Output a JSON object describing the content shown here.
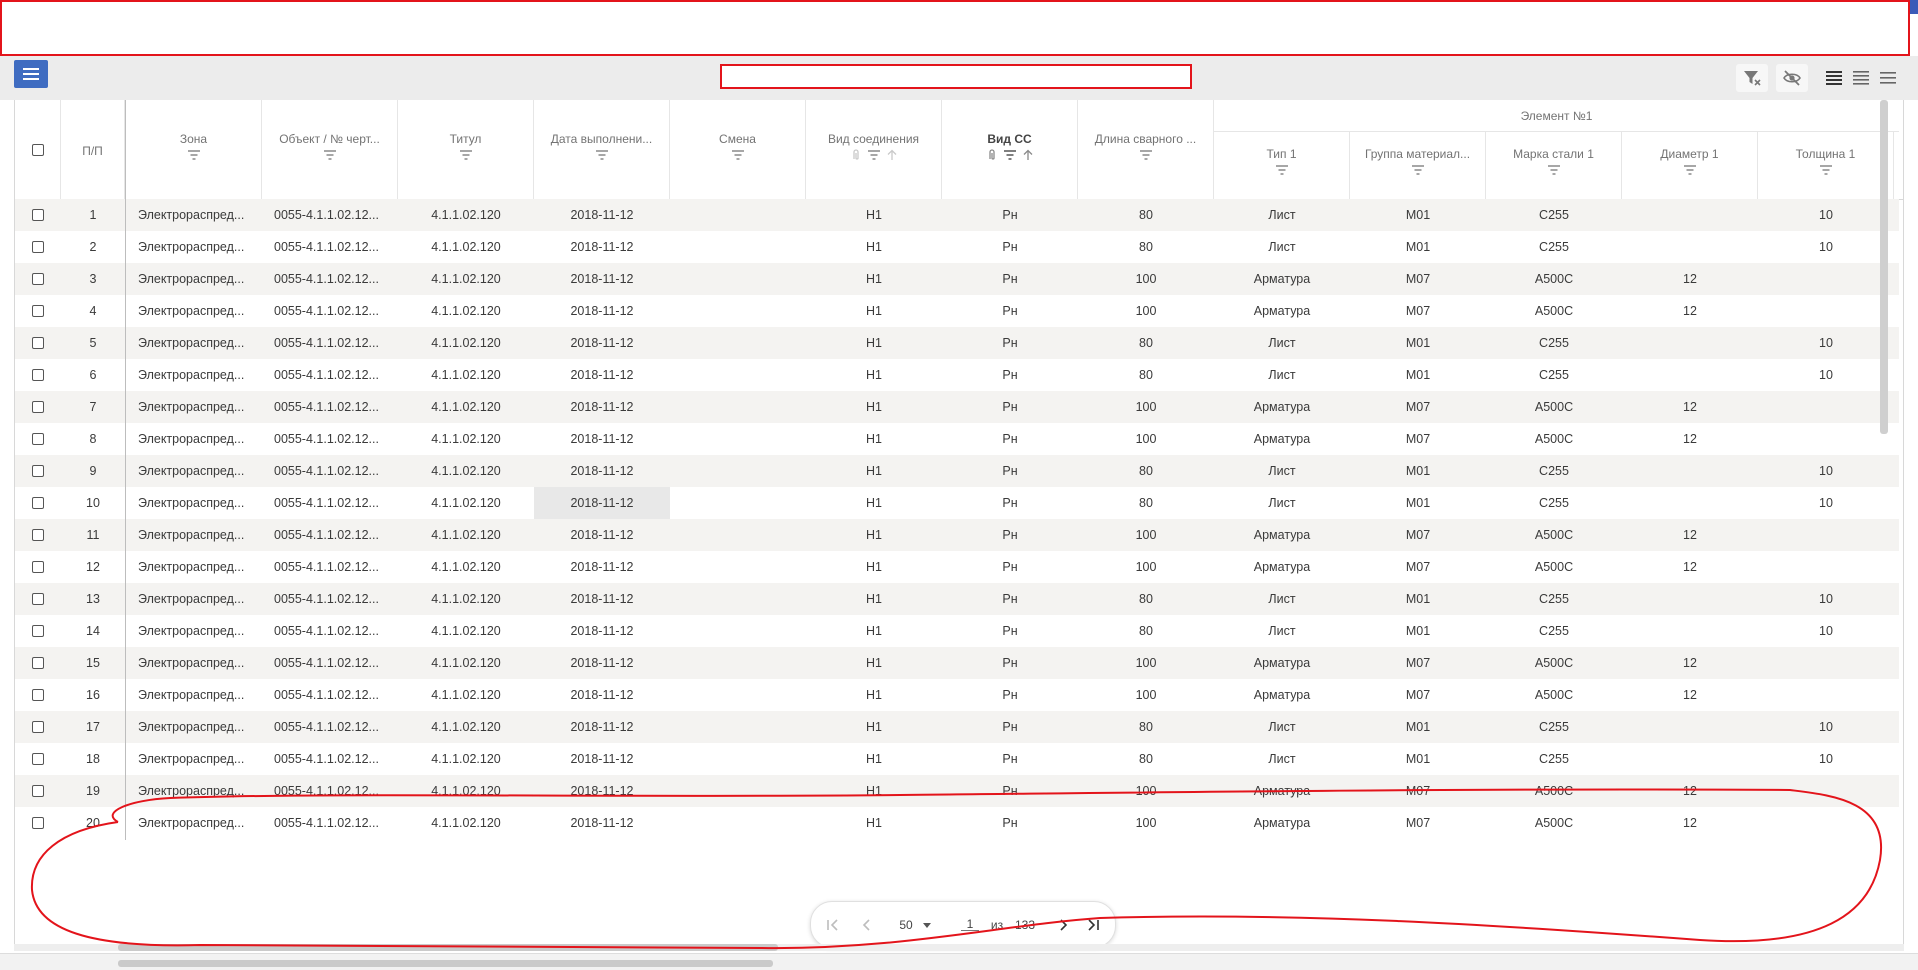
{
  "toolbar": {
    "menu_icon": "hamburger-menu-icon",
    "tools": [
      "filter-clear-icon",
      "hide-columns-icon",
      "density-compact-icon",
      "density-standard-icon",
      "density-comfortable-icon"
    ]
  },
  "table": {
    "columns": {
      "pp": "П/П",
      "zone": "Зона",
      "object": "Объект / № черт...",
      "title": "Титул",
      "date": "Дата выполнени...",
      "shift": "Смена",
      "joint_type": "Вид соединения",
      "ss_type": "Вид СС",
      "weld_length": "Длина сварного ...",
      "group": "Элемент №1",
      "type1": "Тип 1",
      "material_group": "Группа материал...",
      "steel_grade": "Марка стали 1",
      "diameter": "Диаметр 1",
      "thickness": "Толщина 1"
    },
    "rows": [
      [
        "1",
        "Электрораспред...",
        "0055-4.1.1.02.12...",
        "4.1.1.02.120",
        "2018-11-12",
        "",
        "Н1",
        "Рн",
        "80",
        "Лист",
        "М01",
        "С255",
        "",
        "10"
      ],
      [
        "2",
        "Электрораспред...",
        "0055-4.1.1.02.12...",
        "4.1.1.02.120",
        "2018-11-12",
        "",
        "Н1",
        "Рн",
        "80",
        "Лист",
        "М01",
        "С255",
        "",
        "10"
      ],
      [
        "3",
        "Электрораспред...",
        "0055-4.1.1.02.12...",
        "4.1.1.02.120",
        "2018-11-12",
        "",
        "Н1",
        "Рн",
        "100",
        "Арматура",
        "М07",
        "А500С",
        "12",
        ""
      ],
      [
        "4",
        "Электрораспред...",
        "0055-4.1.1.02.12...",
        "4.1.1.02.120",
        "2018-11-12",
        "",
        "Н1",
        "Рн",
        "100",
        "Арматура",
        "М07",
        "А500С",
        "12",
        ""
      ],
      [
        "5",
        "Электрораспред...",
        "0055-4.1.1.02.12...",
        "4.1.1.02.120",
        "2018-11-12",
        "",
        "Н1",
        "Рн",
        "80",
        "Лист",
        "М01",
        "С255",
        "",
        "10"
      ],
      [
        "6",
        "Электрораспред...",
        "0055-4.1.1.02.12...",
        "4.1.1.02.120",
        "2018-11-12",
        "",
        "Н1",
        "Рн",
        "80",
        "Лист",
        "М01",
        "С255",
        "",
        "10"
      ],
      [
        "7",
        "Электрораспред...",
        "0055-4.1.1.02.12...",
        "4.1.1.02.120",
        "2018-11-12",
        "",
        "Н1",
        "Рн",
        "100",
        "Арматура",
        "М07",
        "А500С",
        "12",
        ""
      ],
      [
        "8",
        "Электрораспред...",
        "0055-4.1.1.02.12...",
        "4.1.1.02.120",
        "2018-11-12",
        "",
        "Н1",
        "Рн",
        "100",
        "Арматура",
        "М07",
        "А500С",
        "12",
        ""
      ],
      [
        "9",
        "Электрораспред...",
        "0055-4.1.1.02.12...",
        "4.1.1.02.120",
        "2018-11-12",
        "",
        "Н1",
        "Рн",
        "80",
        "Лист",
        "М01",
        "С255",
        "",
        "10"
      ],
      [
        "10",
        "Электрораспред...",
        "0055-4.1.1.02.12...",
        "4.1.1.02.120",
        "2018-11-12",
        "",
        "Н1",
        "Рн",
        "80",
        "Лист",
        "М01",
        "С255",
        "",
        "10"
      ],
      [
        "11",
        "Электрораспред...",
        "0055-4.1.1.02.12...",
        "4.1.1.02.120",
        "2018-11-12",
        "",
        "Н1",
        "Рн",
        "100",
        "Арматура",
        "М07",
        "А500С",
        "12",
        ""
      ],
      [
        "12",
        "Электрораспред...",
        "0055-4.1.1.02.12...",
        "4.1.1.02.120",
        "2018-11-12",
        "",
        "Н1",
        "Рн",
        "100",
        "Арматура",
        "М07",
        "А500С",
        "12",
        ""
      ],
      [
        "13",
        "Электрораспред...",
        "0055-4.1.1.02.12...",
        "4.1.1.02.120",
        "2018-11-12",
        "",
        "Н1",
        "Рн",
        "80",
        "Лист",
        "М01",
        "С255",
        "",
        "10"
      ],
      [
        "14",
        "Электрораспред...",
        "0055-4.1.1.02.12...",
        "4.1.1.02.120",
        "2018-11-12",
        "",
        "Н1",
        "Рн",
        "80",
        "Лист",
        "М01",
        "С255",
        "",
        "10"
      ],
      [
        "15",
        "Электрораспред...",
        "0055-4.1.1.02.12...",
        "4.1.1.02.120",
        "2018-11-12",
        "",
        "Н1",
        "Рн",
        "100",
        "Арматура",
        "М07",
        "А500С",
        "12",
        ""
      ],
      [
        "16",
        "Электрораспред...",
        "0055-4.1.1.02.12...",
        "4.1.1.02.120",
        "2018-11-12",
        "",
        "Н1",
        "Рн",
        "100",
        "Арматура",
        "М07",
        "А500С",
        "12",
        ""
      ],
      [
        "17",
        "Электрораспред...",
        "0055-4.1.1.02.12...",
        "4.1.1.02.120",
        "2018-11-12",
        "",
        "Н1",
        "Рн",
        "80",
        "Лист",
        "М01",
        "С255",
        "",
        "10"
      ],
      [
        "18",
        "Электрораспред...",
        "0055-4.1.1.02.12...",
        "4.1.1.02.120",
        "2018-11-12",
        "",
        "Н1",
        "Рн",
        "80",
        "Лист",
        "М01",
        "С255",
        "",
        "10"
      ],
      [
        "19",
        "Электрораспред...",
        "0055-4.1.1.02.12...",
        "4.1.1.02.120",
        "2018-11-12",
        "",
        "Н1",
        "Рн",
        "100",
        "Арматура",
        "М07",
        "А500С",
        "12",
        ""
      ],
      [
        "20",
        "Электрораспред...",
        "0055-4.1.1.02.12...",
        "4.1.1.02.120",
        "2018-11-12",
        "",
        "Н1",
        "Рн",
        "100",
        "Арматура",
        "М07",
        "А500С",
        "12",
        ""
      ]
    ],
    "selected_cell": "2018-11-12"
  },
  "pagination": {
    "page_size": "50",
    "current_page": "1",
    "of_label": "из",
    "total_pages": "133"
  },
  "colors": {
    "accent": "#3f6cc1",
    "annotation": "#e3141b",
    "row_stripe": "#f4f3f1"
  }
}
